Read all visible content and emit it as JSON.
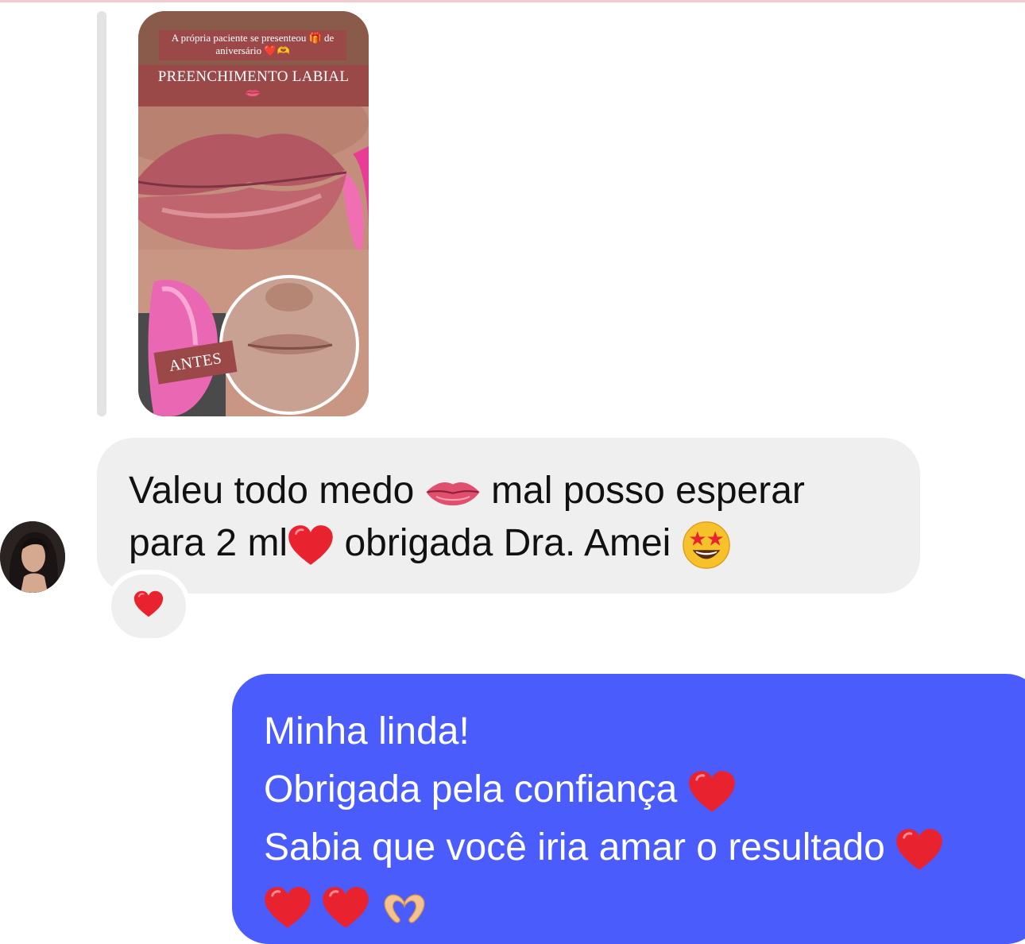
{
  "story": {
    "caption": "A própria paciente se presenteou 🎁 de aniversário ❤️🫶",
    "title": "PREENCHIMENTO LABIAL",
    "before_tag": "ANTES"
  },
  "incoming_message": {
    "line1_a": "Valeu todo medo",
    "line1_b": "mal posso esperar",
    "line2_a": "para 2 ml",
    "line2_b": "obrigada Dra. Amei",
    "reaction": "heart"
  },
  "outgoing_message": {
    "line1": "Minha linda!",
    "line2": "Obrigada pela confiança",
    "line3": "Sabia que você iria amar o resultado"
  },
  "icons": {
    "lips": "lips-emoji-icon",
    "heart": "red-heart-emoji-icon",
    "star_eyes": "star-struck-emoji-icon",
    "heart_hands": "heart-hands-emoji-icon"
  },
  "colors": {
    "incoming_bubble": "#efefef",
    "outgoing_bubble": "#4a5cfc",
    "story_band": "#9a4848",
    "heart": "#e8232f"
  }
}
